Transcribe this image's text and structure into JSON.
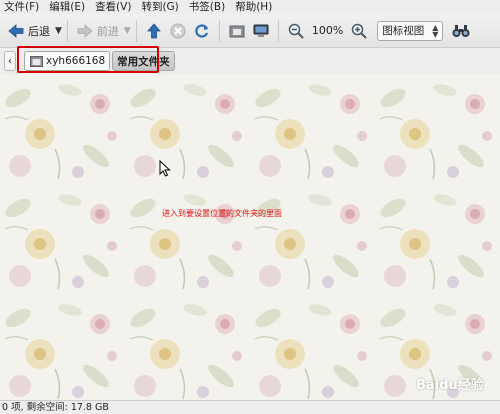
{
  "menubar": {
    "items": [
      "文件(F)",
      "编辑(E)",
      "查看(V)",
      "转到(G)",
      "书签(B)",
      "帮助(H)"
    ]
  },
  "toolbar": {
    "back_label": "后退",
    "forward_label": "前进",
    "zoom_label": "100%",
    "view_mode": "图标视图"
  },
  "pathbar": {
    "folder_label": "xyh666168",
    "common_folder_label": "常用文件夹"
  },
  "content": {
    "instruction": "进入到要设置位置的文件夹的里面",
    "watermark": "Baidu经验"
  },
  "statusbar": {
    "text": "0 项, 剩余空间: 17.8 GB"
  },
  "colors": {
    "highlight": "#d40000",
    "instruction_text": "#e01010",
    "toolbar_blue": "#2f6db3"
  }
}
